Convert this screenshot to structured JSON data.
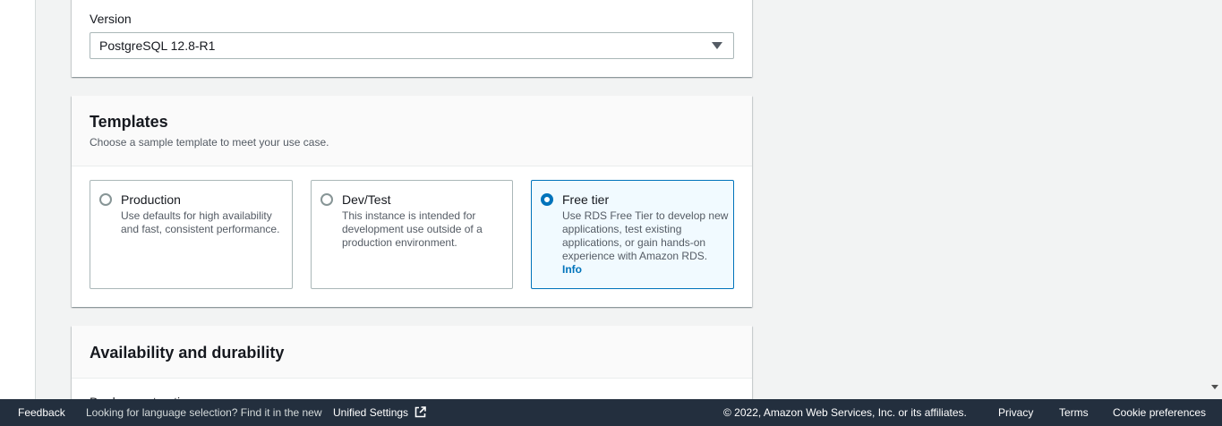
{
  "version_section": {
    "label": "Version",
    "selected_value": "PostgreSQL 12.8-R1"
  },
  "templates": {
    "title": "Templates",
    "description": "Choose a sample template to meet your use case.",
    "options": [
      {
        "title": "Production",
        "description": "Use defaults for high availability and fast, consistent performance.",
        "selected": false
      },
      {
        "title": "Dev/Test",
        "description": "This instance is intended for development use outside of a production environment.",
        "selected": false
      },
      {
        "title": "Free tier",
        "description": "Use RDS Free Tier to develop new applications, test existing applications, or gain hands-on experience with Amazon RDS.",
        "link": "Info",
        "selected": true
      }
    ]
  },
  "availability": {
    "title": "Availability and durability",
    "partial_label": "Deployment options"
  },
  "footer": {
    "feedback": "Feedback",
    "language_prompt": "Looking for language selection? Find it in the new",
    "unified_settings": "Unified Settings",
    "copyright": "© 2022, Amazon Web Services, Inc. or its affiliates.",
    "privacy": "Privacy",
    "terms": "Terms",
    "cookie_preferences": "Cookie preferences"
  },
  "icons": {
    "select_caret": "caret-down-icon",
    "external_link": "external-link-icon"
  },
  "colors": {
    "accent": "#0073bb",
    "footer_bg": "#232f3e",
    "page_bg": "#f2f3f3"
  }
}
